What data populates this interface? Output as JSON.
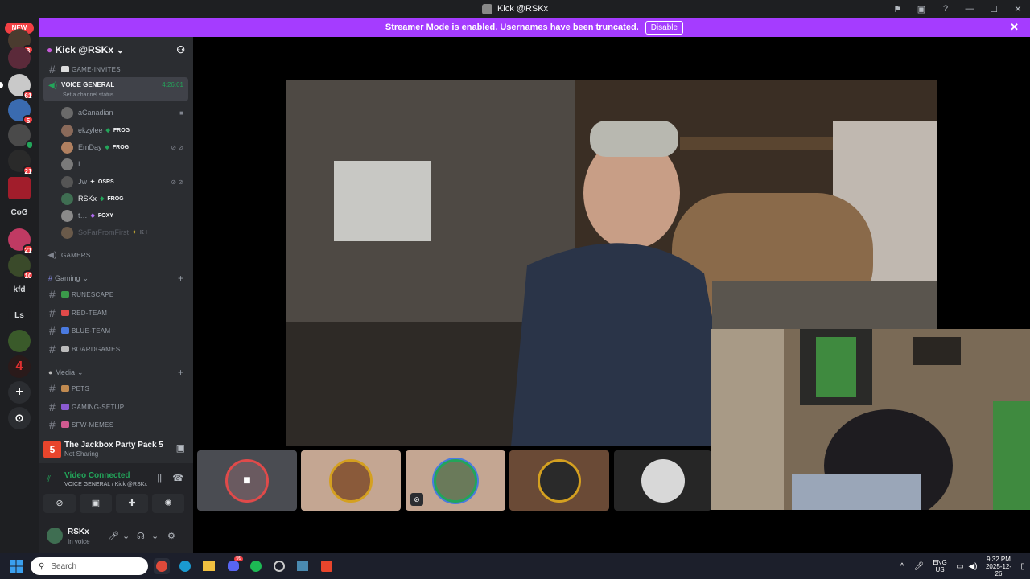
{
  "window": {
    "title": "Kick @RSKx"
  },
  "banner": {
    "text": "Streamer Mode is enabled. Usernames have been truncated.",
    "button": "Disable"
  },
  "rail": {
    "new_badge": "NEW",
    "servers": [
      {
        "badge": "3"
      },
      {
        "badge": ""
      },
      {
        "badge": "61"
      },
      {
        "badge": "5"
      },
      {
        "badge": ""
      },
      {
        "badge": "21"
      },
      {
        "badge": ""
      },
      {
        "label": "CoG"
      },
      {
        "badge": "21"
      },
      {
        "badge": "10"
      },
      {
        "label": "kfd"
      },
      {
        "label": "Ls"
      }
    ],
    "add_label": "+",
    "discover_label": "⊙"
  },
  "guild": {
    "name": "Kick @RSKx"
  },
  "channels": {
    "game_invites": "GAME-INVITES",
    "voice_general": {
      "name": "VOICE GENERAL",
      "status": "Set a channel status",
      "time": "4:26:01"
    },
    "voice_users": [
      {
        "name": "aCanadian",
        "tag": ""
      },
      {
        "name": "ekzylee",
        "tag": "FROG"
      },
      {
        "name": "EmDay",
        "tag": "FROG"
      },
      {
        "name": "I…",
        "tag": ""
      },
      {
        "name": "Jw",
        "tag": "OSRS"
      },
      {
        "name": "RSKx",
        "tag": "FROG"
      },
      {
        "name": "t…",
        "tag": "FOXY"
      },
      {
        "name": "SoFarFromFirst",
        "tag": "K I"
      }
    ],
    "gamers": "GAMERS",
    "cat_gaming": "Gaming",
    "gaming_channels": [
      "RUNESCAPE",
      "RED-TEAM",
      "BLUE-TEAM",
      "BOARDGAMES"
    ],
    "cat_media": "Media",
    "media_channels": [
      "PETS",
      "GAMING-SETUP",
      "SFW-MEMES"
    ]
  },
  "panel": {
    "game_title": "The Jackbox Party Pack 5",
    "game_status": "Not Sharing",
    "voice_status": "Video Connected",
    "voice_location": "VOICE GENERAL / Kick @RSKx",
    "user_name": "RSKx",
    "user_status": "In voice"
  },
  "taskbar": {
    "search_placeholder": "Search",
    "lang": "ENG",
    "region": "US",
    "time": "9:32 PM",
    "date": "2025-12-26",
    "discord_badge": "99"
  },
  "colors": {
    "banner": "#a53cff",
    "voice_green": "#23a55a",
    "badge_red": "#f23f43"
  }
}
